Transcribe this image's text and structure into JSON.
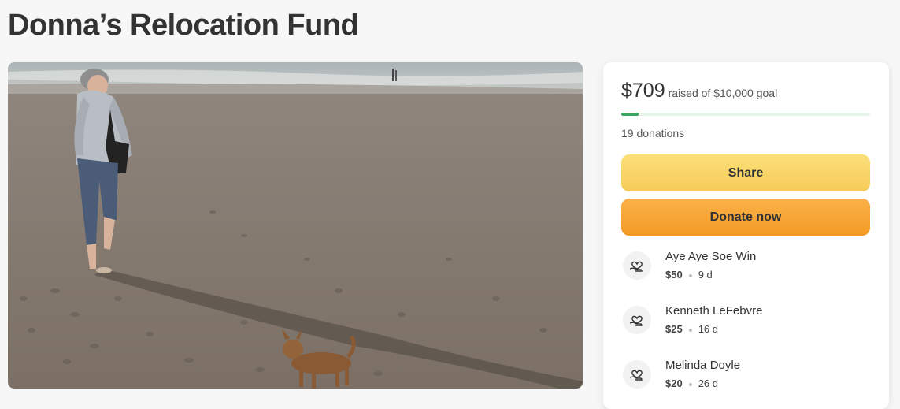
{
  "page": {
    "title": "Donna’s Relocation Fund"
  },
  "fundraiser": {
    "raised": "$709",
    "goal_text": "raised of $10,000 goal",
    "progress_fraction": 0.0709,
    "donation_count": "19 donations",
    "share_label": "Share",
    "donate_label": "Donate now"
  },
  "donors": [
    {
      "name": "Aye Aye Soe Win",
      "amount": "$50",
      "time": "9 d"
    },
    {
      "name": "Kenneth LeFebvre",
      "amount": "$25",
      "time": "16 d"
    },
    {
      "name": "Melinda Doyle",
      "amount": "$20",
      "time": "26 d"
    }
  ],
  "colors": {
    "progress": "#3aa660",
    "share_button": "#f6cc58",
    "donate_button": "#f39a25"
  },
  "icons": {
    "donor": "heart-hand-icon"
  }
}
